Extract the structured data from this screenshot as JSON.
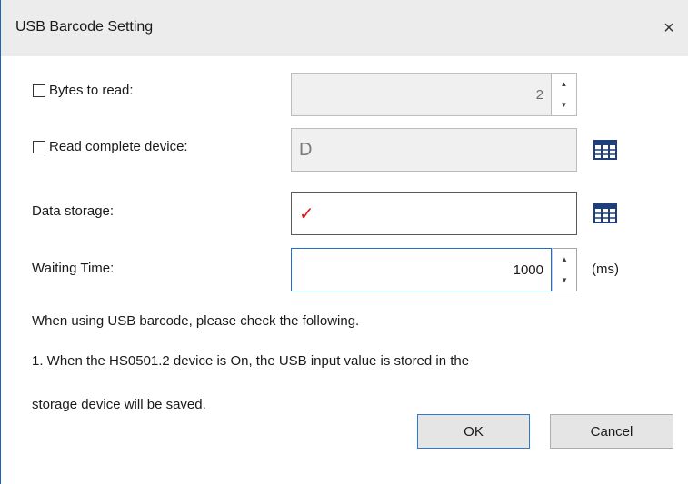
{
  "dialog": {
    "title": "USB Barcode Setting",
    "close_glyph": "×"
  },
  "bytes_to_read": {
    "label": "Bytes to read:",
    "checked": false,
    "value": "2"
  },
  "read_complete_device": {
    "label": "Read complete device:",
    "checked": false,
    "value": "D"
  },
  "data_storage": {
    "label": "Data storage:",
    "value": "✓"
  },
  "waiting_time": {
    "label": "Waiting Time:",
    "value": "1000",
    "unit": "(ms)"
  },
  "info": {
    "line1": "When using USB barcode, please check the following.",
    "line2": "1. When the HS0501.2 device is On, the USB input value is stored in the",
    "line3": "storage device will be saved."
  },
  "buttons": {
    "ok": "OK",
    "cancel": "Cancel"
  },
  "colors": {
    "accent": "#1f6fd1",
    "checkmark": "#e01818",
    "titlebar": "#ececec"
  }
}
